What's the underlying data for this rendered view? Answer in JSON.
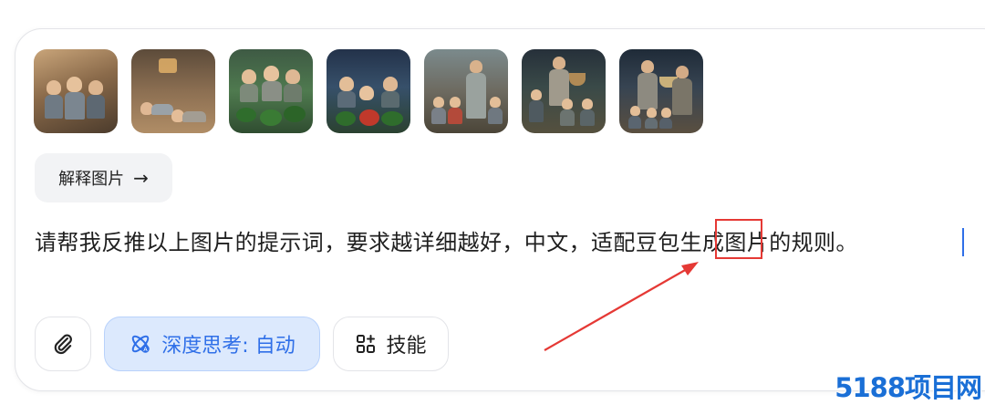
{
  "thumbnails": [
    {
      "name": "thumbnail-1"
    },
    {
      "name": "thumbnail-2"
    },
    {
      "name": "thumbnail-3"
    },
    {
      "name": "thumbnail-4"
    },
    {
      "name": "thumbnail-5"
    },
    {
      "name": "thumbnail-6"
    },
    {
      "name": "thumbnail-7"
    }
  ],
  "explain_chip": {
    "label": "解释图片",
    "icon": "arrow-right-icon",
    "arrow": "→"
  },
  "prompt": {
    "before": "请帮我反推以上图片的提示词，要求越详细越好，中文，适配",
    "highlight": "豆包",
    "after": "生成图片的规则。"
  },
  "toolbar": {
    "attach_icon": "paperclip-icon",
    "think_label": "深度思考: 自动",
    "think_icon": "atom-icon",
    "skills_label": "技能",
    "skills_icon": "grid-plus-icon"
  },
  "watermark": {
    "text": "5188项目网"
  },
  "colors": {
    "accent": "#2f6fe8",
    "think_bg": "#dce9fd",
    "annotation_red": "#e53935",
    "watermark_blue": "#1a6fd6"
  }
}
